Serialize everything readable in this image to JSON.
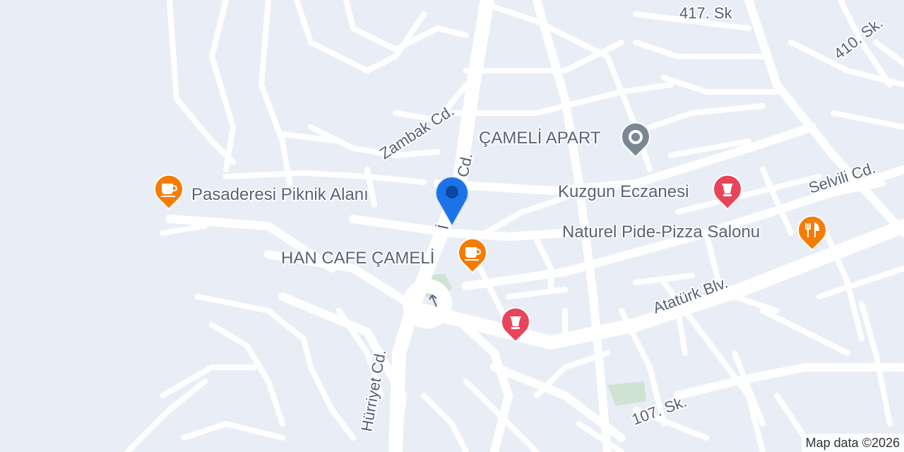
{
  "map": {
    "background": "#e9edf6",
    "road_color": "#ffffff",
    "park_color": "#cfe3d3",
    "attribution": "Map data ©2026"
  },
  "streets": {
    "s417": "417. Sk",
    "s410": "410. Sk.",
    "zambak": "Zambak Cd.",
    "cd_partial": "Cd.",
    "i_partial": "İ",
    "selvili": "Selvili Cd.",
    "ataturk": "Atatürk Blv.",
    "hurriyet": "Hürriyet Cd.",
    "s107": "107. Sk."
  },
  "pois": [
    {
      "id": "cameli-apart",
      "label": "ÇAMELİ APART",
      "icon": "place-icon",
      "color": "#7b8794"
    },
    {
      "id": "kuzgun",
      "label": "Kuzgun Eczanesi",
      "icon": "pharmacy-icon",
      "color": "#e8445a"
    },
    {
      "id": "naturel",
      "label": "Naturel Pide-Pizza Salonu",
      "icon": "restaurant-icon",
      "color": "#f57c00"
    },
    {
      "id": "pasaderesi",
      "label": "Pasaderesi Piknik Alanı",
      "icon": "cafe-icon",
      "color": "#f57c00"
    },
    {
      "id": "han-cafe",
      "label": "HAN CAFE ÇAMELİ",
      "icon": "cafe-icon",
      "color": "#f57c00"
    },
    {
      "id": "pharmacy-2",
      "label": "",
      "icon": "pharmacy-icon",
      "color": "#e8445a"
    }
  ],
  "location_marker": {
    "icon": "location-pin-icon",
    "color": "#1a73e8"
  }
}
